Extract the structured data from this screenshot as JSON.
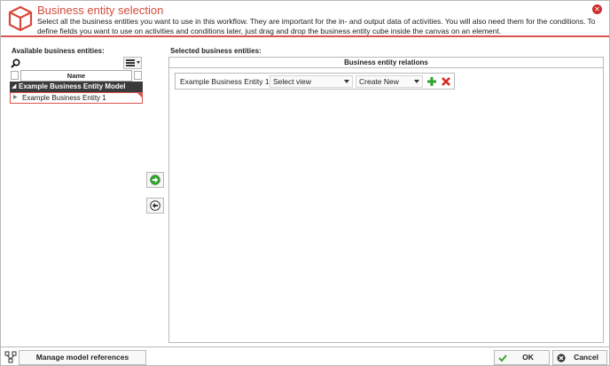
{
  "dialog": {
    "title": "Business entity selection",
    "description": "Select all the business entities you want to use in this workflow. They are important for the in- and output data of activities. You will also need them for the conditions. To define fields you want to use on activities and conditions later, just drag and drop the business entity cube inside the canvas on an element.",
    "accent_color": "#d64a3b"
  },
  "left_panel": {
    "label": "Available business entities:",
    "column_header": "Name",
    "tree": [
      {
        "label": "Example Business Entity Model",
        "children": [
          {
            "label": "Example Business Entity 1"
          }
        ]
      }
    ]
  },
  "right_panel": {
    "label": "Selected business entities:",
    "table_header": "Business entity relations",
    "rows": [
      {
        "entity": "Example Business Entity 1",
        "view_value": "Select view",
        "create_value": "Create New"
      }
    ]
  },
  "footer": {
    "manage_label": "Manage model references",
    "ok_label": "OK",
    "cancel_label": "Cancel"
  },
  "icons": {
    "header": "cube-icon",
    "close": "close-icon",
    "search": "search-icon",
    "move_right": "arrow-right-icon",
    "move_left": "arrow-left-icon",
    "add": "plus-icon",
    "delete": "x-icon",
    "ok": "checkmark-icon",
    "cancel": "cancel-icon"
  }
}
